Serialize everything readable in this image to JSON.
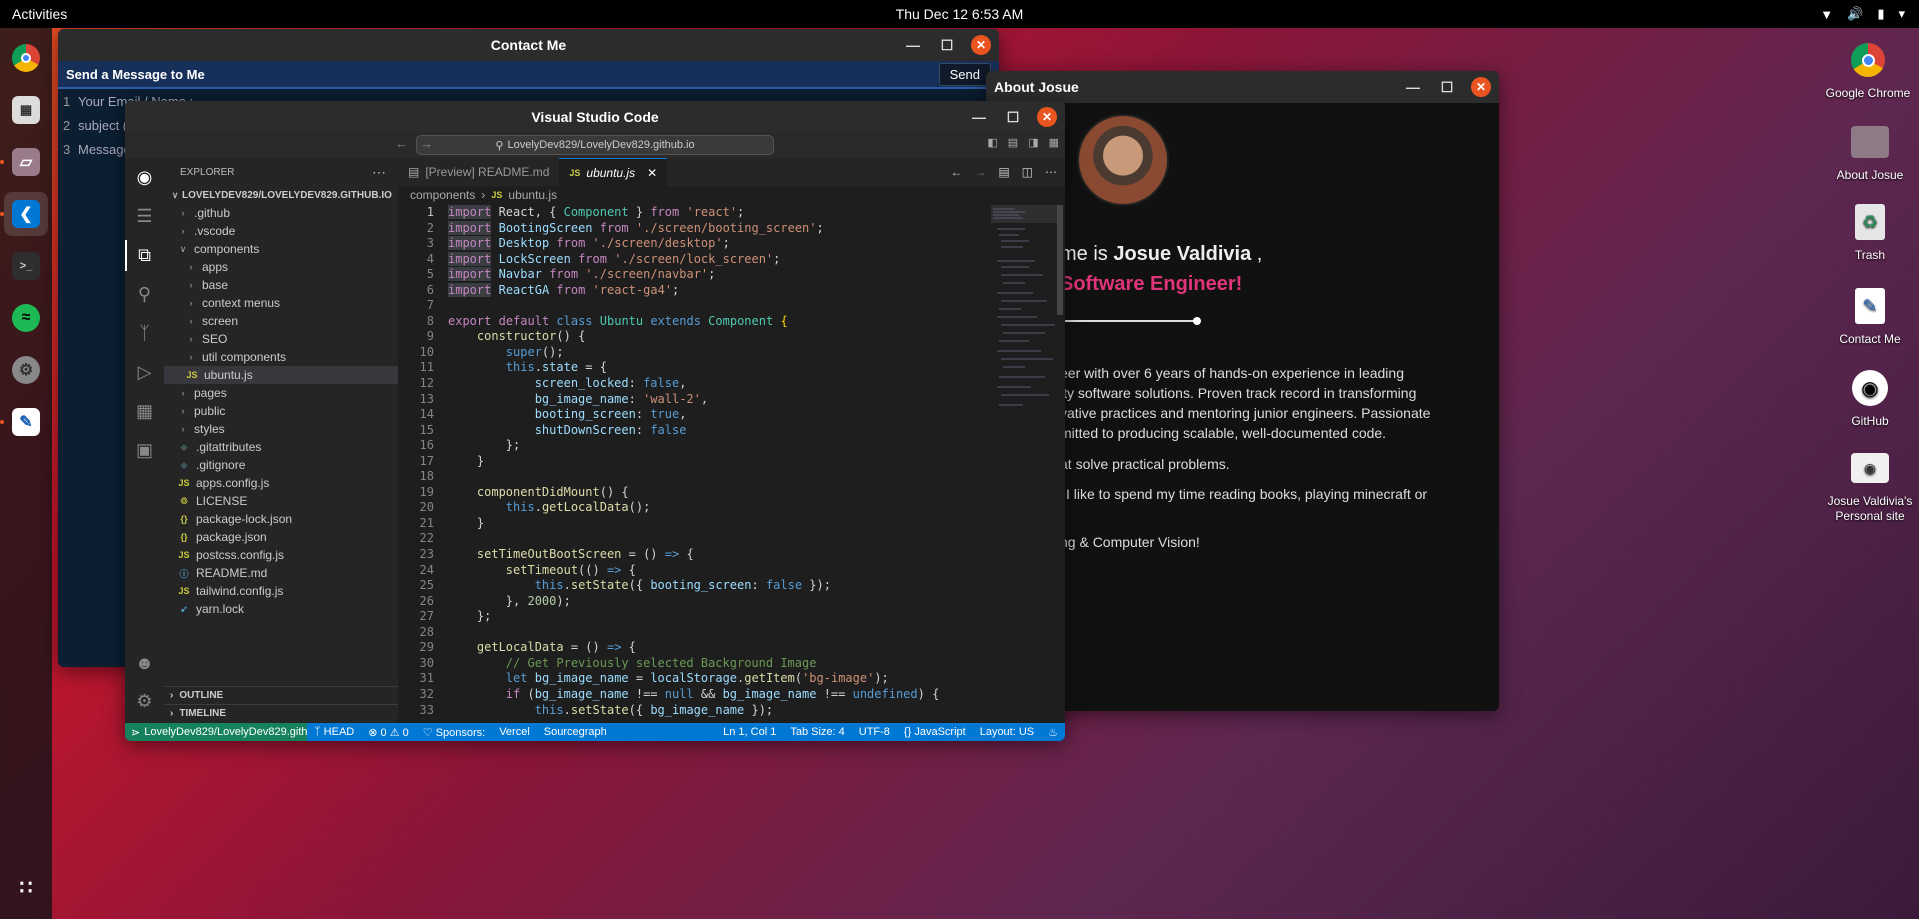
{
  "topbar": {
    "activities": "Activities",
    "clock": "Thu Dec 12  6:53 AM"
  },
  "desktop_icons": [
    {
      "label": "Google Chrome",
      "icon": "chrome-icon"
    },
    {
      "label": "About Josue",
      "icon": "folder-icon"
    },
    {
      "label": "Trash",
      "icon": "trash-icon"
    },
    {
      "label": "Contact Me",
      "icon": "contact-icon"
    },
    {
      "label": "GitHub",
      "icon": "github-icon"
    },
    {
      "label": "Josue Valdivia's Personal site",
      "icon": "personal-site-icon"
    }
  ],
  "contact": {
    "title": "Contact Me",
    "heading": "Send a Message to Me",
    "send": "Send",
    "rows": [
      {
        "n": "1",
        "text": "Your Email / Name :"
      },
      {
        "n": "2",
        "text": "subject (r"
      },
      {
        "n": "3",
        "text": "Message"
      }
    ]
  },
  "about": {
    "title": "About Josue",
    "name_prefix": "me is ",
    "name": "Josue Valdivia",
    "name_suffix": " ,",
    "role": "Software Engineer!",
    "para": [
      "eer with over 6 years of hands-on experience in leading",
      "ity software solutions. Proven track record in transforming",
      "vative practices and mentoring junior engineers. Passionate",
      "mitted to producing scalable, well-documented code."
    ],
    "line2": "at solve practical problems.",
    "line3": "I like to spend my time reading books, playing minecraft or",
    "line4": "ng & Computer Vision!",
    "line5": ")"
  },
  "vscode": {
    "title": "Visual Studio Code",
    "search": "LovelyDev829/LovelyDev829.github.io",
    "explorer": "EXPLORER",
    "root": "LOVELYDEV829/LOVELYDEV829.GITHUB.IO",
    "tree": [
      {
        "label": ".github",
        "kind": "folder",
        "depth": 0,
        "open": false
      },
      {
        "label": ".vscode",
        "kind": "folder",
        "depth": 0,
        "open": false
      },
      {
        "label": "components",
        "kind": "folder",
        "depth": 0,
        "open": true
      },
      {
        "label": "apps",
        "kind": "folder",
        "depth": 1,
        "open": false
      },
      {
        "label": "base",
        "kind": "folder",
        "depth": 1,
        "open": false
      },
      {
        "label": "context menus",
        "kind": "folder",
        "depth": 1,
        "open": false
      },
      {
        "label": "screen",
        "kind": "folder",
        "depth": 1,
        "open": false
      },
      {
        "label": "SEO",
        "kind": "folder",
        "depth": 1,
        "open": false
      },
      {
        "label": "util components",
        "kind": "folder",
        "depth": 1,
        "open": false
      },
      {
        "label": "ubuntu.js",
        "kind": "js",
        "depth": 1,
        "selected": true
      },
      {
        "label": "pages",
        "kind": "folder",
        "depth": 0,
        "open": false
      },
      {
        "label": "public",
        "kind": "folder",
        "depth": 0,
        "open": false
      },
      {
        "label": "styles",
        "kind": "folder",
        "depth": 0,
        "open": false
      },
      {
        "label": ".gitattributes",
        "kind": "git",
        "depth": 0
      },
      {
        "label": ".gitignore",
        "kind": "git",
        "depth": 0
      },
      {
        "label": "apps.config.js",
        "kind": "js",
        "depth": 0
      },
      {
        "label": "LICENSE",
        "kind": "license",
        "depth": 0
      },
      {
        "label": "package-lock.json",
        "kind": "json",
        "depth": 0
      },
      {
        "label": "package.json",
        "kind": "json",
        "depth": 0
      },
      {
        "label": "postcss.config.js",
        "kind": "js",
        "depth": 0
      },
      {
        "label": "README.md",
        "kind": "md",
        "depth": 0
      },
      {
        "label": "tailwind.config.js",
        "kind": "js",
        "depth": 0
      },
      {
        "label": "yarn.lock",
        "kind": "yarn",
        "depth": 0
      }
    ],
    "outline": "OUTLINE",
    "timeline": "TIMELINE",
    "tabs": [
      {
        "label": "[Preview] README.md",
        "active": false
      },
      {
        "label": "ubuntu.js",
        "active": true
      }
    ],
    "breadcrumb": [
      "components",
      "ubuntu.js"
    ],
    "status": {
      "remote": "LovelyDev829/LovelyDev829.githu...",
      "branch": "HEAD",
      "problems": "0 ⚠ 0",
      "sponsors": "Sponsors:",
      "vercel": "Vercel",
      "sourcegraph": "Sourcegraph",
      "position": "Ln 1, Col 1",
      "tab": "Tab Size: 4",
      "encoding": "UTF-8",
      "language": "JavaScript",
      "layout": "Layout: US"
    },
    "code": [
      [
        [
          "k",
          "import"
        ],
        [
          "t",
          " React, { "
        ],
        [
          "c",
          "Component"
        ],
        [
          "t",
          " } "
        ],
        [
          "k",
          "from"
        ],
        [
          "t",
          " "
        ],
        [
          "s",
          "'react'"
        ],
        [
          "t",
          ";"
        ]
      ],
      [
        [
          "k",
          "import"
        ],
        [
          "t",
          " "
        ],
        [
          "v",
          "BootingScreen"
        ],
        [
          "t",
          " "
        ],
        [
          "k",
          "from"
        ],
        [
          "t",
          " "
        ],
        [
          "s",
          "'./screen/booting_screen'"
        ],
        [
          "t",
          ";"
        ]
      ],
      [
        [
          "k",
          "import"
        ],
        [
          "t",
          " "
        ],
        [
          "v",
          "Desktop"
        ],
        [
          "t",
          " "
        ],
        [
          "k",
          "from"
        ],
        [
          "t",
          " "
        ],
        [
          "s",
          "'./screen/desktop'"
        ],
        [
          "t",
          ";"
        ]
      ],
      [
        [
          "k",
          "import"
        ],
        [
          "t",
          " "
        ],
        [
          "v",
          "LockScreen"
        ],
        [
          "t",
          " "
        ],
        [
          "k",
          "from"
        ],
        [
          "t",
          " "
        ],
        [
          "s",
          "'./screen/lock_screen'"
        ],
        [
          "t",
          ";"
        ]
      ],
      [
        [
          "k",
          "import"
        ],
        [
          "t",
          " "
        ],
        [
          "v",
          "Navbar"
        ],
        [
          "t",
          " "
        ],
        [
          "k",
          "from"
        ],
        [
          "t",
          " "
        ],
        [
          "s",
          "'./screen/navbar'"
        ],
        [
          "t",
          ";"
        ]
      ],
      [
        [
          "k",
          "import"
        ],
        [
          "t",
          " "
        ],
        [
          "v",
          "ReactGA"
        ],
        [
          "t",
          " "
        ],
        [
          "k",
          "from"
        ],
        [
          "t",
          " "
        ],
        [
          "s",
          "'react-ga4'"
        ],
        [
          "t",
          ";"
        ]
      ],
      [],
      [
        [
          "k",
          "export"
        ],
        [
          "t",
          " "
        ],
        [
          "k",
          "default"
        ],
        [
          "t",
          " "
        ],
        [
          "b",
          "class"
        ],
        [
          "t",
          " "
        ],
        [
          "c",
          "Ubuntu"
        ],
        [
          "t",
          " "
        ],
        [
          "b",
          "extends"
        ],
        [
          "t",
          " "
        ],
        [
          "c",
          "Component"
        ],
        [
          "t",
          " "
        ],
        [
          "y",
          "{"
        ]
      ],
      [
        [
          "t",
          "    "
        ],
        [
          "f",
          "constructor"
        ],
        [
          "t",
          "() {"
        ]
      ],
      [
        [
          "t",
          "        "
        ],
        [
          "b",
          "super"
        ],
        [
          "t",
          "();"
        ]
      ],
      [
        [
          "t",
          "        "
        ],
        [
          "b",
          "this"
        ],
        [
          "t",
          "."
        ],
        [
          "v",
          "state"
        ],
        [
          "t",
          " = {"
        ]
      ],
      [
        [
          "t",
          "            "
        ],
        [
          "v",
          "screen_locked"
        ],
        [
          "t",
          ": "
        ],
        [
          "b",
          "false"
        ],
        [
          "t",
          ","
        ]
      ],
      [
        [
          "t",
          "            "
        ],
        [
          "v",
          "bg_image_name"
        ],
        [
          "t",
          ": "
        ],
        [
          "s",
          "'wall-2'"
        ],
        [
          "t",
          ","
        ]
      ],
      [
        [
          "t",
          "            "
        ],
        [
          "v",
          "booting_screen"
        ],
        [
          "t",
          ": "
        ],
        [
          "b",
          "true"
        ],
        [
          "t",
          ","
        ]
      ],
      [
        [
          "t",
          "            "
        ],
        [
          "v",
          "shutDownScreen"
        ],
        [
          "t",
          ": "
        ],
        [
          "b",
          "false"
        ]
      ],
      [
        [
          "t",
          "        };"
        ]
      ],
      [
        [
          "t",
          "    }"
        ]
      ],
      [],
      [
        [
          "t",
          "    "
        ],
        [
          "f",
          "componentDidMount"
        ],
        [
          "t",
          "() {"
        ]
      ],
      [
        [
          "t",
          "        "
        ],
        [
          "b",
          "this"
        ],
        [
          "t",
          "."
        ],
        [
          "f",
          "getLocalData"
        ],
        [
          "t",
          "();"
        ]
      ],
      [
        [
          "t",
          "    }"
        ]
      ],
      [],
      [
        [
          "t",
          "    "
        ],
        [
          "f",
          "setTimeOutBootScreen"
        ],
        [
          "t",
          " = () "
        ],
        [
          "b",
          "=>"
        ],
        [
          "t",
          " {"
        ]
      ],
      [
        [
          "t",
          "        "
        ],
        [
          "f",
          "setTimeout"
        ],
        [
          "t",
          "(() "
        ],
        [
          "b",
          "=>"
        ],
        [
          "t",
          " {"
        ]
      ],
      [
        [
          "t",
          "            "
        ],
        [
          "b",
          "this"
        ],
        [
          "t",
          "."
        ],
        [
          "f",
          "setState"
        ],
        [
          "t",
          "({ "
        ],
        [
          "v",
          "booting_screen"
        ],
        [
          "t",
          ": "
        ],
        [
          "b",
          "false"
        ],
        [
          "t",
          " });"
        ]
      ],
      [
        [
          "t",
          "        }, "
        ],
        [
          "n",
          "2000"
        ],
        [
          "t",
          ");"
        ]
      ],
      [
        [
          "t",
          "    };"
        ]
      ],
      [],
      [
        [
          "t",
          "    "
        ],
        [
          "f",
          "getLocalData"
        ],
        [
          "t",
          " = () "
        ],
        [
          "b",
          "=>"
        ],
        [
          "t",
          " {"
        ]
      ],
      [
        [
          "t",
          "        "
        ],
        [
          "cm",
          "// Get Previously selected Background Image"
        ]
      ],
      [
        [
          "t",
          "        "
        ],
        [
          "b",
          "let"
        ],
        [
          "t",
          " "
        ],
        [
          "v",
          "bg_image_name"
        ],
        [
          "t",
          " = "
        ],
        [
          "v",
          "localStorage"
        ],
        [
          "t",
          "."
        ],
        [
          "f",
          "getItem"
        ],
        [
          "t",
          "("
        ],
        [
          "s",
          "'bg-image'"
        ],
        [
          "t",
          ");"
        ]
      ],
      [
        [
          "t",
          "        "
        ],
        [
          "k",
          "if"
        ],
        [
          "t",
          " ("
        ],
        [
          "v",
          "bg_image_name"
        ],
        [
          "t",
          " !== "
        ],
        [
          "b",
          "null"
        ],
        [
          "t",
          " && "
        ],
        [
          "v",
          "bg_image_name"
        ],
        [
          "t",
          " !== "
        ],
        [
          "b",
          "undefined"
        ],
        [
          "t",
          ") {"
        ]
      ],
      [
        [
          "t",
          "            "
        ],
        [
          "b",
          "this"
        ],
        [
          "t",
          "."
        ],
        [
          "f",
          "setState"
        ],
        [
          "t",
          "({ "
        ],
        [
          "v",
          "bg_image_name"
        ],
        [
          "t",
          " });"
        ]
      ]
    ]
  }
}
